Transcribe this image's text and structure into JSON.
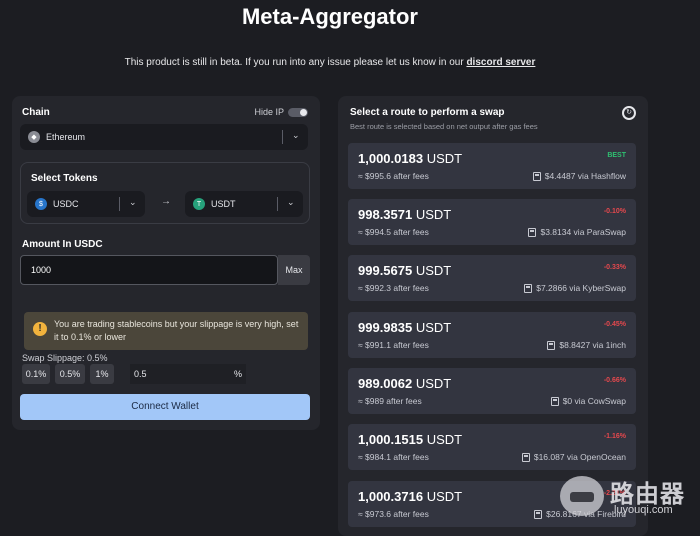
{
  "header": {
    "title": "Meta-Aggregator",
    "beta_note": "This product is still in beta. If you run into any issue please let us know in our",
    "beta_link": "discord server"
  },
  "left": {
    "chain_label": "Chain",
    "hide_ip_label": "Hide IP",
    "hide_ip_on": false,
    "chain_value": "Ethereum",
    "select_tokens_label": "Select Tokens",
    "token_from": "USDC",
    "token_to": "USDT",
    "arrow": "→",
    "amount_label": "Amount In USDC",
    "amount_value": "1000",
    "max_label": "Max",
    "warning_text": "You are trading stablecoins but your slippage is very high, set it to 0.1% or lower",
    "slippage_label": "Swap Slippage: 0.5%",
    "slippage_options": [
      "0.1%",
      "0.5%",
      "1%"
    ],
    "slippage_value": "0.5",
    "slippage_unit": "%",
    "connect_label": "Connect Wallet"
  },
  "right": {
    "title": "Select a route to perform a swap",
    "subtitle": "Best route is selected based on net output after gas fees",
    "routes": [
      {
        "amount": "1,000.0183",
        "unit": "USDT",
        "fees": "≈ $995.6 after fees",
        "badge": "BEST",
        "via": "$4.4487 via Hashflow"
      },
      {
        "amount": "998.3571",
        "unit": "USDT",
        "fees": "≈ $994.5 after fees",
        "badge": "-0.10%",
        "via": "$3.8134 via ParaSwap"
      },
      {
        "amount": "999.5675",
        "unit": "USDT",
        "fees": "≈ $992.3 after fees",
        "badge": "-0.33%",
        "via": "$7.2866 via KyberSwap"
      },
      {
        "amount": "999.9835",
        "unit": "USDT",
        "fees": "≈ $991.1 after fees",
        "badge": "-0.45%",
        "via": "$8.8427 via 1inch"
      },
      {
        "amount": "989.0062",
        "unit": "USDT",
        "fees": "≈ $989 after fees",
        "badge": "-0.66%",
        "via": "$0 via CowSwap"
      },
      {
        "amount": "1,000.1515",
        "unit": "USDT",
        "fees": "≈ $984.1 after fees",
        "badge": "-1.16%",
        "via": "$16.087 via OpenOcean"
      },
      {
        "amount": "1,000.3716",
        "unit": "USDT",
        "fees": "≈ $973.6 after fees",
        "badge": "-2.21%",
        "via": "$26.8167 via Firebird"
      }
    ]
  },
  "watermark": {
    "cn": "路由器",
    "url": "luyouqi.com"
  },
  "colors": {
    "accent_button": "#a2c7f8",
    "best_badge": "#2fbf71",
    "negative_badge": "#e5484d",
    "usdc_icon": "#2775ca",
    "usdt_icon": "#26a17b"
  }
}
